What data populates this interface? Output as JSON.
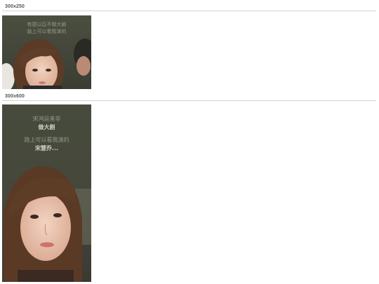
{
  "sections": [
    {
      "label": "300x250",
      "ad": {
        "line1": "有德以后不做大剧",
        "line2": "路上可以看我演的"
      }
    },
    {
      "label": "300x600",
      "ad": {
        "line1": "宋鸿延来非",
        "line2": "做大剧",
        "line3": "路上可以看我演的",
        "line4": "宋慧乔..."
      }
    }
  ],
  "colors": {
    "ad_background": "#44483a",
    "divider": "#d4d4d4",
    "label": "#555555"
  }
}
